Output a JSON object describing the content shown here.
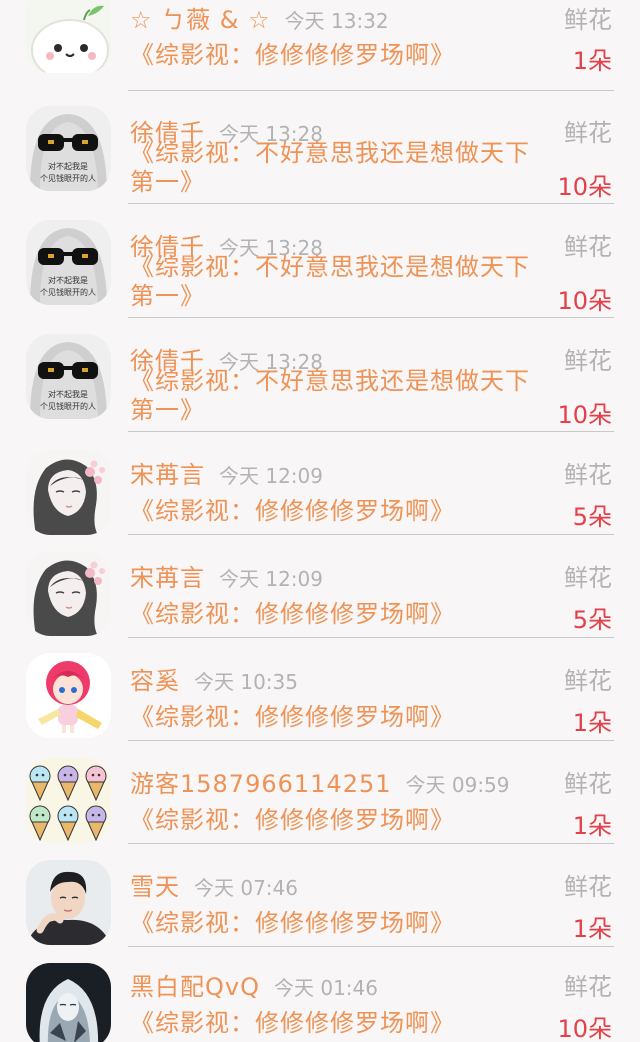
{
  "items": [
    {
      "name": "☆ ㄅ薇 & ☆",
      "time": "今天 13:32",
      "gift": "鲜花",
      "message": "《综影视：修修修修罗场啊》",
      "count": "1朵",
      "avatar": "bun-face-avatar"
    },
    {
      "name": "徐倩千",
      "time": "今天 13:28",
      "gift": "鲜花",
      "message": "《综影视：不好意思我还是想做天下第一》",
      "count": "10朵",
      "avatar": "sunglasses-ghost-avatar"
    },
    {
      "name": "徐倩千",
      "time": "今天 13:28",
      "gift": "鲜花",
      "message": "《综影视：不好意思我还是想做天下第一》",
      "count": "10朵",
      "avatar": "sunglasses-ghost-avatar"
    },
    {
      "name": "徐倩千",
      "time": "今天 13:28",
      "gift": "鲜花",
      "message": "《综影视：不好意思我还是想做天下第一》",
      "count": "10朵",
      "avatar": "sunglasses-ghost-avatar"
    },
    {
      "name": "宋苒言",
      "time": "今天 12:09",
      "gift": "鲜花",
      "message": "《综影视：修修修修罗场啊》",
      "count": "5朵",
      "avatar": "sketch-girl-avatar"
    },
    {
      "name": "宋苒言",
      "time": "今天 12:09",
      "gift": "鲜花",
      "message": "《综影视：修修修修罗场啊》",
      "count": "5朵",
      "avatar": "sketch-girl-avatar"
    },
    {
      "name": "容奚",
      "time": "今天 10:35",
      "gift": "鲜花",
      "message": "《综影视：修修修修罗场啊》",
      "count": "1朵",
      "avatar": "chibi-girl-avatar"
    },
    {
      "name": "游客1587966114251",
      "time": "今天 09:59",
      "gift": "鲜花",
      "message": "《综影视：修修修修罗场啊》",
      "count": "1朵",
      "avatar": "ice-cream-avatar"
    },
    {
      "name": "雪天",
      "time": "今天 07:46",
      "gift": "鲜花",
      "message": "《综影视：修修修修罗场啊》",
      "count": "1朵",
      "avatar": "man-portrait-avatar"
    },
    {
      "name": "黑白配QvQ",
      "time": "今天 01:46",
      "gift": "鲜花",
      "message": "《综影视：修修修修罗场啊》",
      "count": "10朵",
      "avatar": "dark-anime-avatar"
    }
  ],
  "avatar_lettering": {
    "sunglasses-ghost-avatar": "对不起我是个见钱眼开的人"
  }
}
